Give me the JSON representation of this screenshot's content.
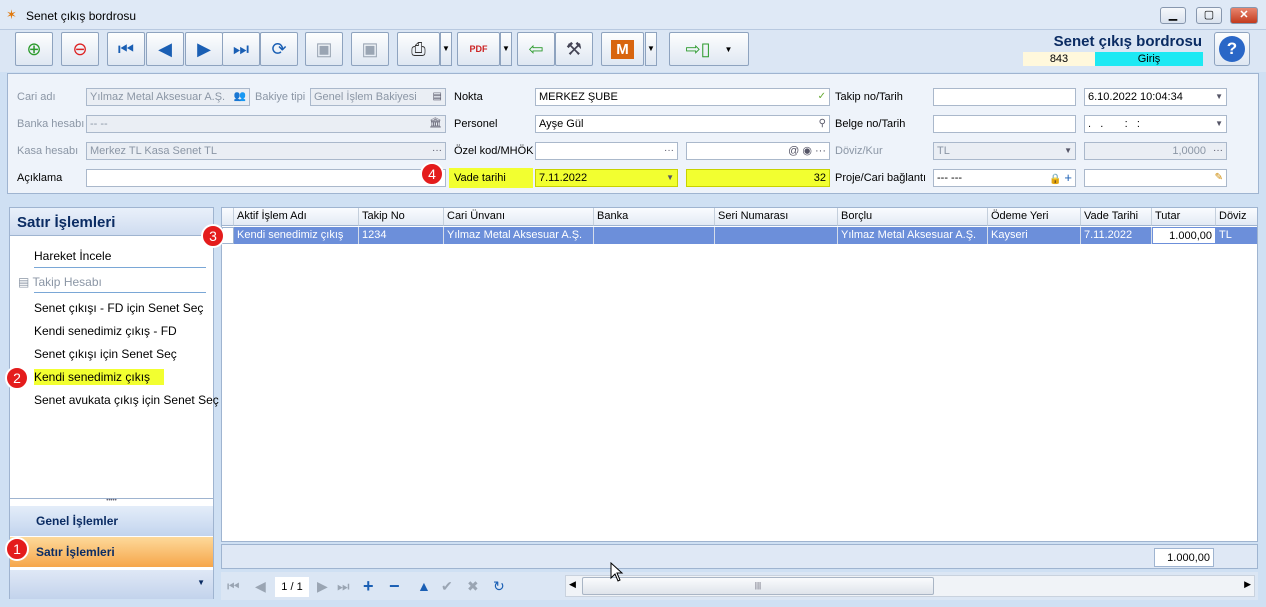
{
  "window": {
    "title": "Senet çıkış bordrosu",
    "min": "▁",
    "max": "▢",
    "close": "✕"
  },
  "header": {
    "doc_title": "Senet çıkış bordrosu",
    "doc_no": "843",
    "doc_state": "Giriş",
    "help": "?"
  },
  "toolbar": {
    "pdf": "PDF",
    "m": "M"
  },
  "form": {
    "cari_adi": {
      "label": "Cari adı",
      "value": "Yılmaz Metal Aksesuar A.Ş."
    },
    "bakiye_tipi": {
      "label": "Bakiye tipi",
      "value": "Genel İşlem Bakiyesi"
    },
    "banka_hesabi": {
      "label": "Banka hesabı",
      "value": "-- --"
    },
    "kasa_hesabi": {
      "label": "Kasa hesabı",
      "value": "Merkez TL Kasa Senet TL"
    },
    "aciklama": {
      "label": "Açıklama",
      "value": ""
    },
    "nokta": {
      "label": "Nokta",
      "value": "MERKEZ ŞUBE"
    },
    "personel": {
      "label": "Personel",
      "value": "Ayşe Gül"
    },
    "ozel_kod": {
      "label": "Özel kod/MHÖK",
      "value": ""
    },
    "vade_tarihi": {
      "label": "Vade tarihi",
      "value": "7.11.2022",
      "days": "32"
    },
    "takip_no": {
      "label": "Takip no/Tarih",
      "value": "",
      "date": "6.10.2022 10:04:34"
    },
    "belge_no": {
      "label": "Belge no/Tarih",
      "value": "",
      "date": ".   .       :   :"
    },
    "doviz_kur": {
      "label": "Döviz/Kur",
      "currency": "TL",
      "rate": "1,0000"
    },
    "proje": {
      "label": "Proje/Cari bağlantı",
      "value": "--- ---",
      "value2": ""
    }
  },
  "left_panel": {
    "title": "Satır İşlemleri",
    "items": [
      "Hareket İncele",
      "Takip Hesabı",
      "Senet çıkışı - FD için Senet Seç",
      "Kendi senedimiz çıkış - FD",
      "Senet çıkışı için Senet Seç",
      "Kendi senedimiz çıkış",
      "Senet avukata çıkış için Senet Seç"
    ],
    "nav_genel": "Genel İşlemler",
    "nav_satir": "Satır İşlemleri",
    "splitter": "•••••"
  },
  "grid": {
    "columns": [
      "Aktif İşlem Adı",
      "Takip No",
      "Cari Ünvanı",
      "Banka",
      "Seri Numarası",
      "Borçlu",
      "Ödeme Yeri",
      "Vade Tarihi",
      "Tutar",
      "Döviz"
    ],
    "rows": [
      [
        "Kendi senedimiz çıkış",
        "1234",
        "Yılmaz Metal Aksesuar A.Ş.",
        "",
        "",
        "Yılmaz Metal Aksesuar A.Ş.",
        "Kayseri",
        "7.11.2022",
        "1.000,00",
        "TL"
      ]
    ],
    "total": "1.000,00"
  },
  "navbar": {
    "pager": "1 / 1",
    "scroll_grip": "|||"
  },
  "badges": [
    "1",
    "2",
    "3",
    "4"
  ],
  "colors": {
    "highlight": "#f2ff30",
    "selected_row": "#6c8fda",
    "badge": "#e41c1c",
    "state": "#1de9f3",
    "active_nav": "#f6a64a"
  }
}
